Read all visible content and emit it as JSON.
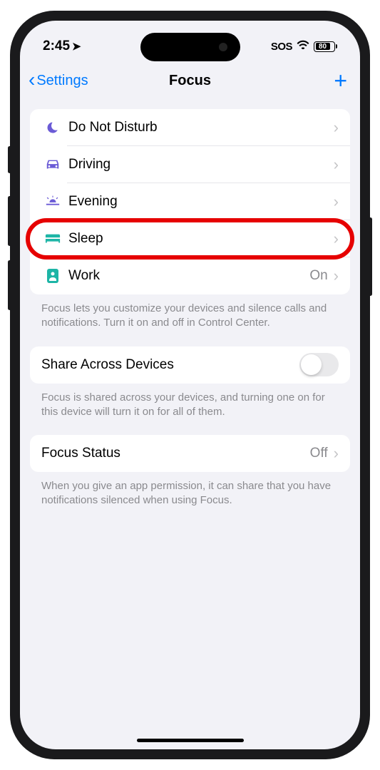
{
  "statusBar": {
    "time": "2:45",
    "sos": "SOS",
    "battery": "80"
  },
  "nav": {
    "back": "Settings",
    "title": "Focus"
  },
  "focusModes": [
    {
      "id": "dnd",
      "label": "Do Not Disturb",
      "iconColor": "purple",
      "icon": "moon"
    },
    {
      "id": "driving",
      "label": "Driving",
      "iconColor": "purple",
      "icon": "car"
    },
    {
      "id": "evening",
      "label": "Evening",
      "iconColor": "purple",
      "icon": "sunset"
    },
    {
      "id": "sleep",
      "label": "Sleep",
      "iconColor": "teal",
      "icon": "bed",
      "highlighted": true
    },
    {
      "id": "work",
      "label": "Work",
      "iconColor": "teal",
      "icon": "badge",
      "value": "On"
    }
  ],
  "footers": {
    "modes": "Focus lets you customize your devices and silence calls and notifications. Turn it on and off in Control Center.",
    "share": "Focus is shared across your devices, and turning one on for this device will turn it on for all of them.",
    "status": "When you give an app permission, it can share that you have notifications silenced when using Focus."
  },
  "share": {
    "label": "Share Across Devices",
    "on": false
  },
  "status": {
    "label": "Focus Status",
    "value": "Off"
  }
}
